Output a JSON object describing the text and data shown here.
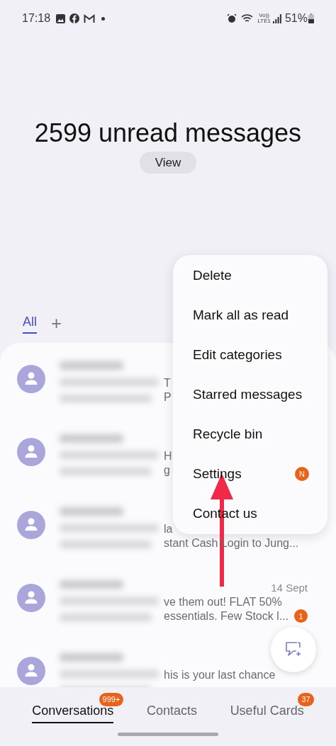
{
  "status_bar": {
    "time": "17:18",
    "volte_top": "Vo))",
    "volte_bottom": "LTE1",
    "battery": "51%"
  },
  "header": {
    "title": "2599 unread messages",
    "view_button": "View"
  },
  "category_tabs": [
    {
      "label": "All",
      "selected": true
    }
  ],
  "add_category": "+",
  "conversations": [
    {
      "lines": [
        "T",
        "P"
      ]
    },
    {
      "lines": [
        "H",
        "g"
      ]
    },
    {
      "lines": [
        "la",
        "stant Cash Login to Jung..."
      ]
    },
    {
      "date": "14 Sept",
      "lines": [
        "ve them out! FLAT 50%",
        "essentials. Few Stock l..."
      ],
      "badge": "1"
    },
    {
      "lines": [
        "his is your last chance"
      ]
    }
  ],
  "menu": [
    {
      "label": "Delete"
    },
    {
      "label": "Mark all as read"
    },
    {
      "label": "Edit categories"
    },
    {
      "label": "Starred messages"
    },
    {
      "label": "Recycle bin"
    },
    {
      "label": "Settings",
      "badge": "N"
    },
    {
      "label": "Contact us"
    }
  ],
  "bottom_tabs": [
    {
      "label": "Conversations",
      "selected": true,
      "badge": "999+"
    },
    {
      "label": "Contacts",
      "selected": false
    },
    {
      "label": "Useful Cards",
      "selected": false,
      "badge": "37"
    }
  ]
}
